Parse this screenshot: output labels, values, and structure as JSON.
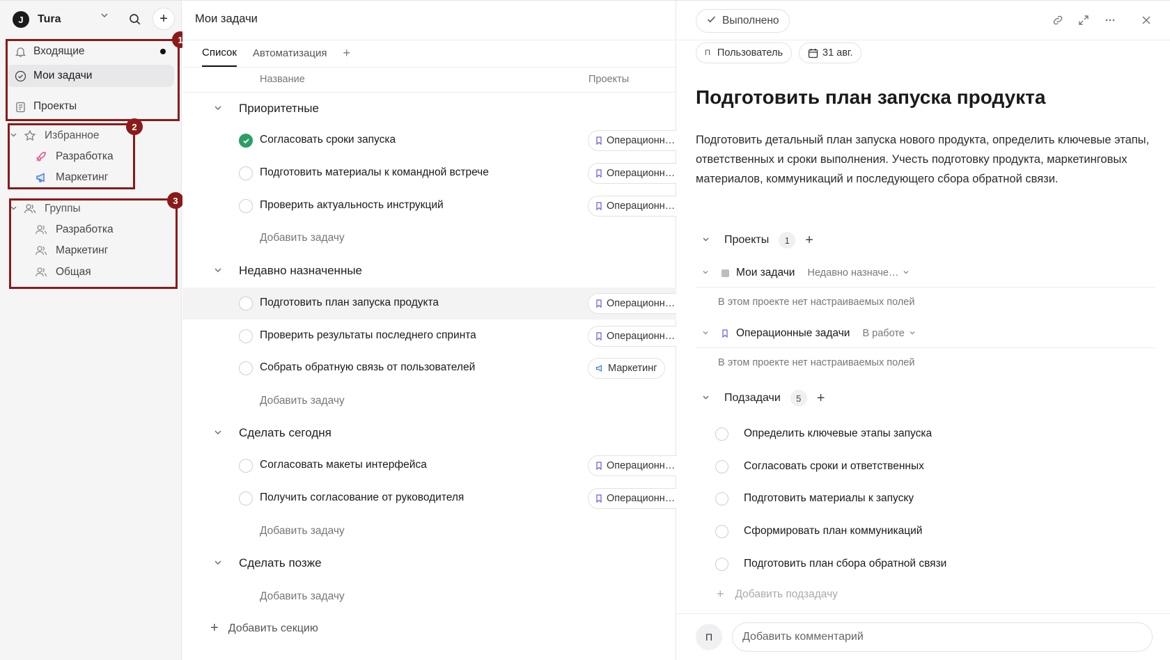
{
  "workspace": {
    "logo": "J",
    "name": "Tura"
  },
  "sidebar": {
    "inbox": "Входящие",
    "my_tasks": "Мои задачи",
    "projects": "Проекты",
    "favorites": {
      "label": "Избранное",
      "items": [
        "Разработка",
        "Маркетинг"
      ]
    },
    "groups": {
      "label": "Группы",
      "items": [
        "Разработка",
        "Маркетинг",
        "Общая"
      ]
    },
    "badges": [
      "1",
      "2",
      "3"
    ]
  },
  "middle": {
    "title": "Мои задачи",
    "tabs": [
      "Список",
      "Автоматизация"
    ],
    "columns": {
      "name": "Название",
      "projects": "Проекты"
    },
    "add_task": "Добавить задачу",
    "add_section": "Добавить секцию",
    "sections": [
      {
        "name": "Приоритетные",
        "tasks": [
          {
            "title": "Согласовать сроки запуска",
            "project": "Операционн…",
            "done": true
          },
          {
            "title": "Подготовить материалы к командной встрече",
            "project": "Операционн…",
            "done": false
          },
          {
            "title": "Проверить актуальность инструкций",
            "project": "Операционн…",
            "done": false
          }
        ]
      },
      {
        "name": "Недавно назначенные",
        "tasks": [
          {
            "title": "Подготовить план запуска продукта",
            "project": "Операционн…",
            "done": false
          },
          {
            "title": "Проверить результаты последнего спринта",
            "project": "Операционн…",
            "done": false
          },
          {
            "title": "Собрать обратную связь от пользователей",
            "project": "Маркетинг",
            "done": false
          }
        ]
      },
      {
        "name": "Сделать сегодня",
        "tasks": [
          {
            "title": "Согласовать макеты интерфейса",
            "project": "Операционн…",
            "done": false
          },
          {
            "title": "Получить согласование от руководителя",
            "project": "Операционн…",
            "done": false
          }
        ]
      },
      {
        "name": "Сделать позже",
        "tasks": []
      }
    ]
  },
  "detail": {
    "done_label": "Выполнено",
    "assignee_initial": "П",
    "assignee": "Пользователь",
    "due": "31 авг.",
    "title": "Подготовить план запуска продукта",
    "description": "Подготовить детальный план запуска нового продукта, определить ключевые этапы, ответственных и сроки выполнения. Учесть подготовку продукта, маркетинговых материалов, коммуникаций и последующего сбора обратной связи.",
    "projects_label": "Проекты",
    "projects_count": "1",
    "projects": [
      {
        "name": "Мои задачи",
        "status": "Недавно назначе…",
        "note": "В этом проекте нет настраиваемых полей"
      },
      {
        "name": "Операционные задачи",
        "status": "В работе",
        "note": "В этом проекте нет настраиваемых полей"
      }
    ],
    "subtasks_label": "Подзадачи",
    "subtasks_count": "5",
    "subtasks": [
      "Определить ключевые этапы запуска",
      "Согласовать сроки и ответственных",
      "Подготовить материалы к запуску",
      "Сформировать план коммуникаций",
      "Подготовить план сбора обратной связи"
    ],
    "add_subtask": "Добавить подзадачу",
    "comment_initial": "П",
    "comment_placeholder": "Добавить комментарий"
  },
  "colors": {
    "accent_done": "#2e9e64",
    "highlight": "#8b1a1a",
    "marketing_icon": "#3b6fd8",
    "dev_icon": "#e04f8a"
  }
}
